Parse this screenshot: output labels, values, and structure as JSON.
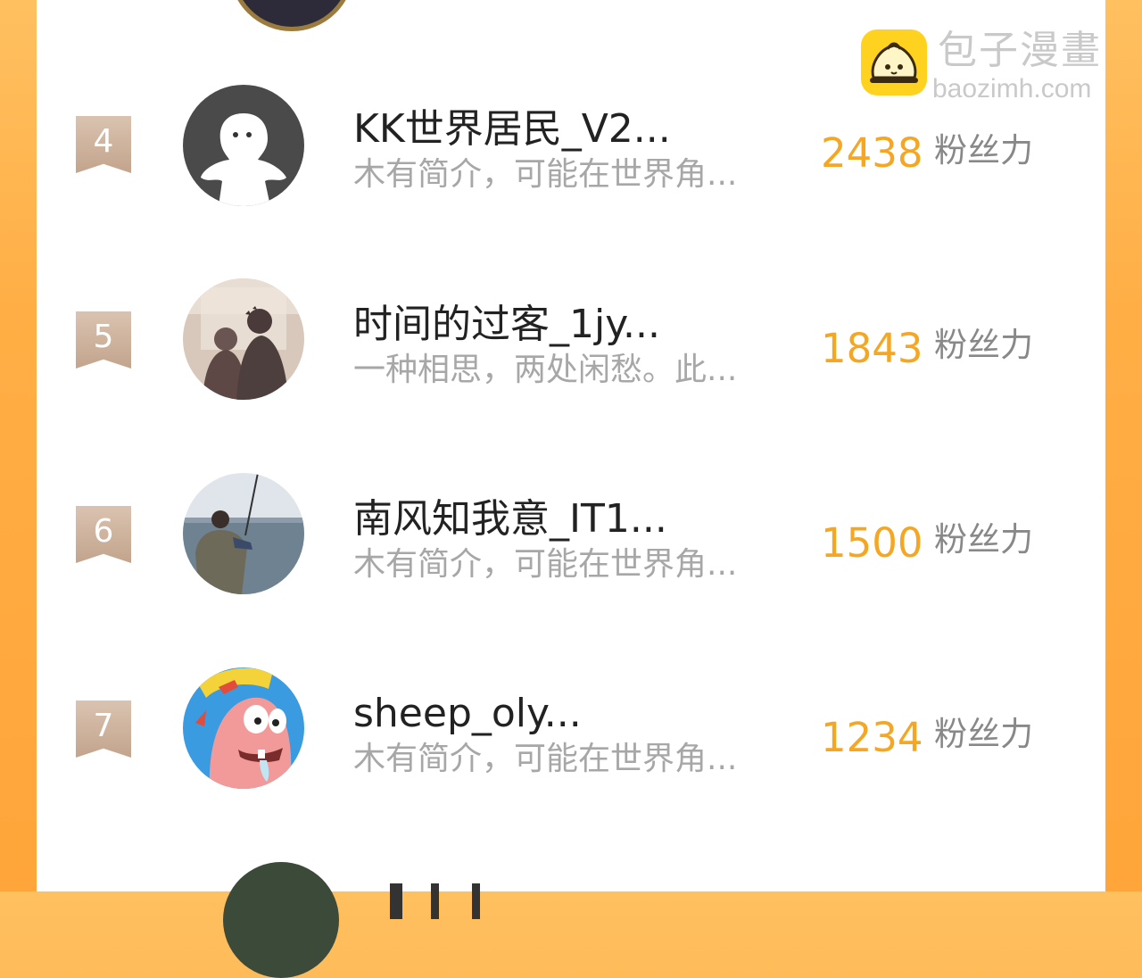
{
  "watermark": {
    "title": "包子漫畫",
    "url": "baozimh.com",
    "logo_icon": "baozi-bun-icon",
    "logo_color": "#ffd21f"
  },
  "colors": {
    "background_orange": "#ffa53a",
    "fans_number": "#f5a623",
    "rank_badge": "#c9ab93"
  },
  "ranking": [
    {
      "rank": "4",
      "name": "KK世界居民_V2...",
      "bio": "木有简介，可能在世界角...",
      "fans": "2438",
      "fans_label": "粉丝力",
      "avatar_icon": "default-ghost-avatar-icon"
    },
    {
      "rank": "5",
      "name": "时间的过客_1jy...",
      "bio": "一种相思，两处闲愁。此...",
      "fans": "1843",
      "fans_label": "粉丝力",
      "avatar_icon": "couple-photo-avatar"
    },
    {
      "rank": "6",
      "name": "南风知我意_IT1...",
      "bio": "木有简介，可能在世界角...",
      "fans": "1500",
      "fans_label": "粉丝力",
      "avatar_icon": "fisherman-sea-avatar"
    },
    {
      "rank": "7",
      "name": "sheep_oly...",
      "bio": "木有简介，可能在世界角...",
      "fans": "1234",
      "fans_label": "粉丝力",
      "avatar_icon": "patrick-cartoon-avatar"
    }
  ]
}
